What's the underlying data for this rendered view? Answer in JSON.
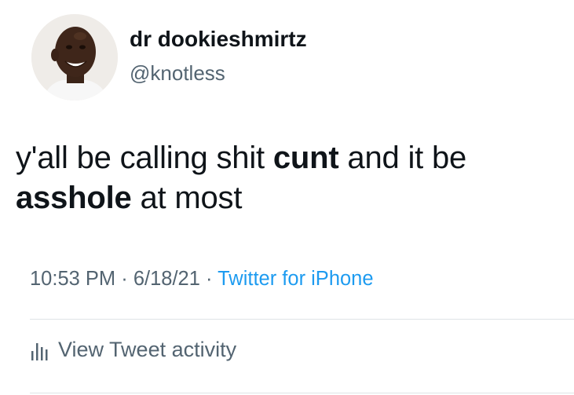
{
  "user": {
    "display_name": "dr dookieshmirtz",
    "handle": "@knotless",
    "avatar_icon": "profile-photo"
  },
  "tweet": {
    "text_part1": "y'all be calling shit ",
    "bold1": "cunt",
    "text_part2": " and it be ",
    "bold2": "asshole",
    "text_part3": " at most"
  },
  "meta": {
    "time": "10:53 PM",
    "sep1": " · ",
    "date": "6/18/21",
    "sep2": " · ",
    "source": "Twitter for iPhone"
  },
  "activity": {
    "label": "View Tweet activity",
    "icon": "bar-chart-icon"
  },
  "colors": {
    "text": "#0f1419",
    "secondary": "#536471",
    "link": "#1d9bf0",
    "divider": "#dfe3e6"
  }
}
